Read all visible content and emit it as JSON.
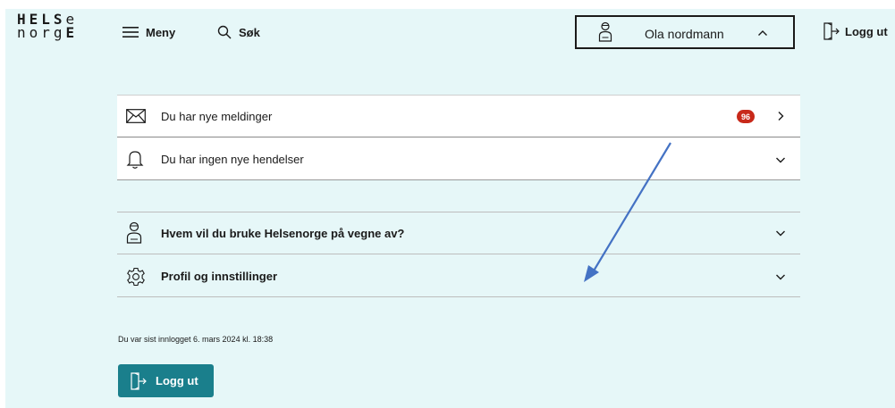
{
  "header": {
    "logo_line1": "HELSe",
    "logo_line2": "norgE",
    "menu_label": "Meny",
    "search_label": "Søk",
    "user_name": "Ola nordmann",
    "logout_label": "Logg ut"
  },
  "notifications": {
    "messages_label": "Du har nye meldinger",
    "messages_count": "96",
    "events_label": "Du har ingen nye hendelser"
  },
  "settings": {
    "represent_label": "Hvem vil du bruke Helsenorge på vegne av?",
    "profile_label": "Profil og innstillinger"
  },
  "footer": {
    "last_login": "Du var sist innlogget 6. mars 2024 kl. 18:38",
    "logout_button": "Logg ut"
  },
  "colors": {
    "background": "#e6f7f8",
    "badge": "#c8291a",
    "primary_button": "#1a7f8c",
    "annotation_arrow": "#4472c4"
  },
  "icons": {
    "menu": "hamburger-icon",
    "search": "search-icon",
    "user": "person-icon",
    "logout": "logout-icon",
    "messages": "envelope-icon",
    "events": "bell-icon",
    "represent": "person-icon",
    "profile": "gear-icon"
  }
}
